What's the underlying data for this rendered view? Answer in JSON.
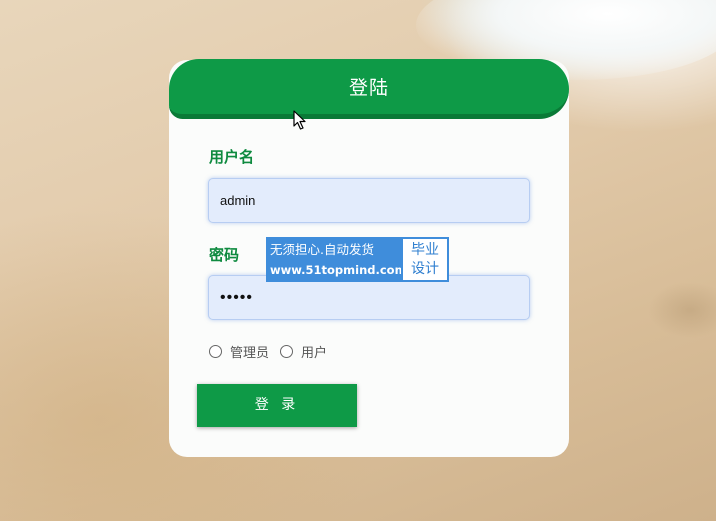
{
  "login": {
    "title": "登陆",
    "username_label": "用户名",
    "username_value": "admin",
    "password_label": "密码",
    "password_value": "•••••",
    "roles": [
      {
        "label": "管理员",
        "checked": false
      },
      {
        "label": "用户",
        "checked": false
      }
    ],
    "submit_label": "登 录"
  },
  "watermark": {
    "line1": "无须担心.自动发货",
    "line2": "www.51topmind.com",
    "badge_line1": "毕业",
    "badge_line2": "设计"
  },
  "colors": {
    "primary_green": "#0e9a47",
    "label_green": "#0e8a3f",
    "input_bg": "#e3ecfc",
    "watermark_blue": "#3f8ddb"
  },
  "icons": {
    "cursor": "mouse-pointer-icon"
  }
}
